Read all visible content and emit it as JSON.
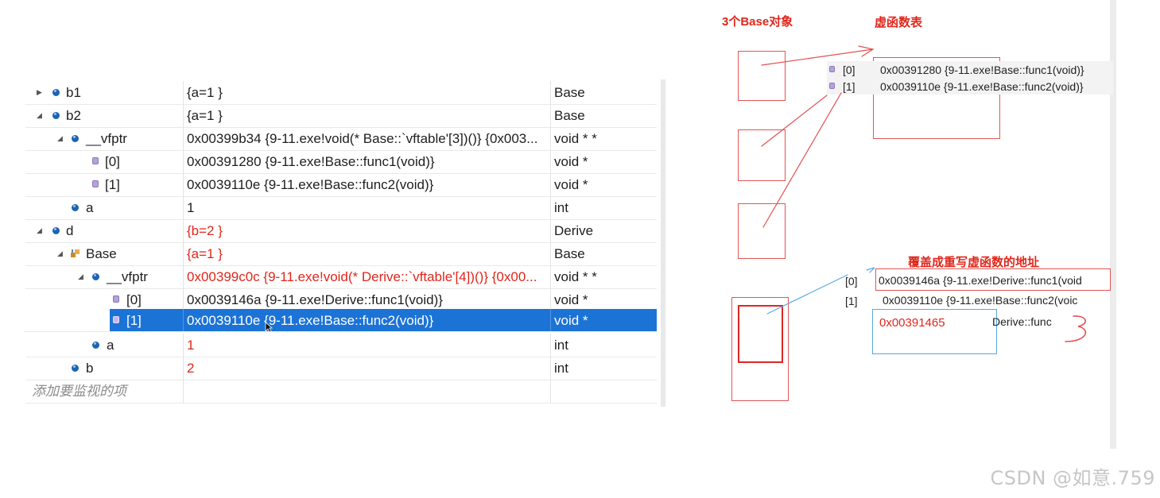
{
  "watch": {
    "rows": [
      {
        "name": "b1",
        "value": "{a=1 }",
        "type": "Base"
      },
      {
        "name": "b2",
        "value": "{a=1 }",
        "type": "Base"
      },
      {
        "name": "__vfptr",
        "value": "0x00399b34 {9-11.exe!void(* Base::`vftable'[3])()} {0x003...",
        "type": "void * *"
      },
      {
        "name": "[0]",
        "value": "0x00391280 {9-11.exe!Base::func1(void)}",
        "type": "void *"
      },
      {
        "name": "[1]",
        "value": "0x0039110e {9-11.exe!Base::func2(void)}",
        "type": "void *"
      },
      {
        "name": "a",
        "value": "1",
        "type": "int"
      },
      {
        "name": "d",
        "value": "{b=2 }",
        "type": "Derive"
      },
      {
        "name": "Base",
        "value": "{a=1 }",
        "type": "Base"
      },
      {
        "name": "__vfptr",
        "value": "0x00399c0c {9-11.exe!void(* Derive::`vftable'[4])()} {0x00...",
        "type": "void * *"
      },
      {
        "name": "[0]",
        "value": "0x0039146a {9-11.exe!Derive::func1(void)}",
        "type": "void *"
      },
      {
        "name": "[1]",
        "value": "0x0039110e {9-11.exe!Base::func2(void)}",
        "type": "void *"
      },
      {
        "name": "a",
        "value": "1",
        "type": "int"
      },
      {
        "name": "b",
        "value": "2",
        "type": "int"
      }
    ],
    "add_item_placeholder": "添加要监视的项"
  },
  "diagram": {
    "label_objects": "3个Base对象",
    "label_vtable": "虚函数表",
    "label_override": "覆盖成重写虚函数的地址",
    "base_vtable": [
      {
        "index": "[0]",
        "text": "0x00391280 {9-11.exe!Base::func1(void)}"
      },
      {
        "index": "[1]",
        "text": "0x0039110e {9-11.exe!Base::func2(void)}"
      }
    ],
    "derive_vtable": [
      {
        "index": "[0]",
        "text": "0x0039146a {9-11.exe!Derive::func1(void"
      },
      {
        "index": "[1]",
        "text": "0x0039110e {9-11.exe!Base::func2(voic"
      }
    ],
    "override_address": "0x00391465",
    "override_func": "Derive::func",
    "handwritten_mark": "3"
  },
  "colors": {
    "selection": "#1c73d6",
    "changed_value": "#e0261b",
    "annotation": "#e0261b",
    "arrow_blue": "#5aa8e0"
  },
  "watermark": "CSDN @如意.759"
}
